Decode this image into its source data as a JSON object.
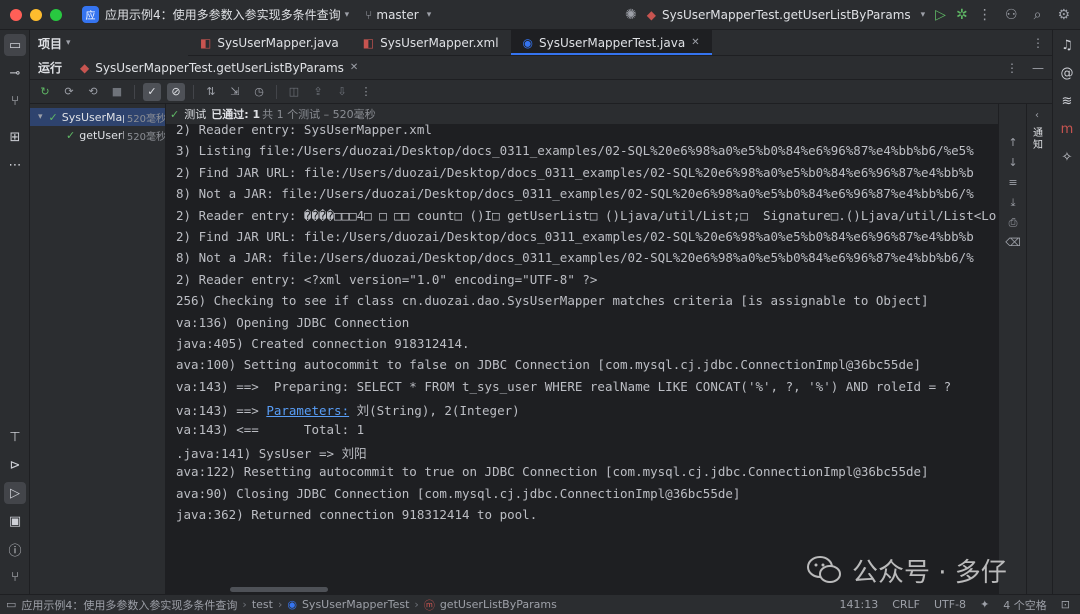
{
  "titlebar": {
    "project_badge": "应",
    "project_name": "应用示例4：使用多参数入参实现多条件查询",
    "branch": "master",
    "run_config": "SysUserMapperTest.getUserListByParams"
  },
  "project_header": {
    "label": "项目"
  },
  "editor_tabs": [
    {
      "label": "SysUserMapper.java",
      "icon_color": "#c75450"
    },
    {
      "label": "SysUserMapper.xml",
      "icon_color": "#c75450"
    },
    {
      "label": "SysUserMapperTest.java",
      "icon_color": "#3574f0"
    }
  ],
  "run_panel": {
    "label": "运行",
    "tab_label": "SysUserMapperTest.getUserListByParams"
  },
  "test_tree": {
    "root": {
      "name": "SysUserMap",
      "time": "520毫秒"
    },
    "child": {
      "name": "getUserLi",
      "time": "520毫秒"
    }
  },
  "console_status": {
    "prefix": "测试",
    "passed": "已通过: 1",
    "detail": "共 1 个测试 – 520毫秒"
  },
  "console_lines": [
    "2) Reader entry: SysUserMapper.xml",
    "3) Listing file:/Users/duozai/Desktop/docs_0311_examples/02-SQL%20e6%98%a0%e5%b0%84%e6%96%87%e4%bb%b6/%e5%",
    "2) Find JAR URL: file:/Users/duozai/Desktop/docs_0311_examples/02-SQL%20e6%98%a0%e5%b0%84%e6%96%87%e4%bb%b",
    "8) Not a JAR: file:/Users/duozai/Desktop/docs_0311_examples/02-SQL%20e6%98%a0%e5%b0%84%e6%96%87%e4%bb%b6/%",
    "2) Reader entry: ����□□□4□ □ □□ count□ ()I□ getUserList□ ()Ljava/util/List;□  Signature□.()Ljava/util/List<Lo",
    "2) Find JAR URL: file:/Users/duozai/Desktop/docs_0311_examples/02-SQL%20e6%98%a0%e5%b0%84%e6%96%87%e4%bb%b",
    "8) Not a JAR: file:/Users/duozai/Desktop/docs_0311_examples/02-SQL%20e6%98%a0%e5%b0%84%e6%96%87%e4%bb%b6/%",
    "2) Reader entry: <?xml version=\"1.0\" encoding=\"UTF-8\" ?>",
    "256) Checking to see if class cn.duozai.dao.SysUserMapper matches criteria [is assignable to Object]",
    "va:136) Opening JDBC Connection",
    "java:405) Created connection 918312414.",
    "ava:100) Setting autocommit to false on JDBC Connection [com.mysql.cj.jdbc.ConnectionImpl@36bc55de]",
    "va:143) ==>  Preparing: SELECT * FROM t_sys_user WHERE realName LIKE CONCAT('%', ?, '%') AND roleId = ?",
    {
      "prefix": "va:143) ==> ",
      "link": "Parameters:",
      "suffix": " 刘(String), 2(Integer)"
    },
    "va:143) <==      Total: 1",
    ".java:141) SysUser => 刘阳",
    "ava:122) Resetting autocommit to true on JDBC Connection [com.mysql.cj.jdbc.ConnectionImpl@36bc55de]",
    "ava:90) Closing JDBC Connection [com.mysql.cj.jdbc.ConnectionImpl@36bc55de]",
    "java:362) Returned connection 918312414 to pool."
  ],
  "right_panel_label": "通知",
  "statusbar": {
    "breadcrumb": [
      "应用示例4：使用多参数入参实现多条件查询",
      "test",
      "SysUserMapperTest",
      "getUserListByParams"
    ],
    "position": "141:13",
    "line_sep": "CRLF",
    "encoding": "UTF-8",
    "indent": "4 个空格"
  },
  "watermark": {
    "text": "公众号 · 多仔"
  },
  "icons": {
    "left_strip": [
      "folder-icon",
      "commit-icon",
      "pull-request-icon",
      "structure-icon",
      "more-icon",
      "build-icon",
      "services-icon",
      "run-icon",
      "terminal-icon",
      "problems-icon",
      "git-icon"
    ],
    "right_strip": [
      "notifications-icon",
      "ai-assistant-icon",
      "database-icon",
      "maven-icon",
      "gradle-icon"
    ]
  }
}
